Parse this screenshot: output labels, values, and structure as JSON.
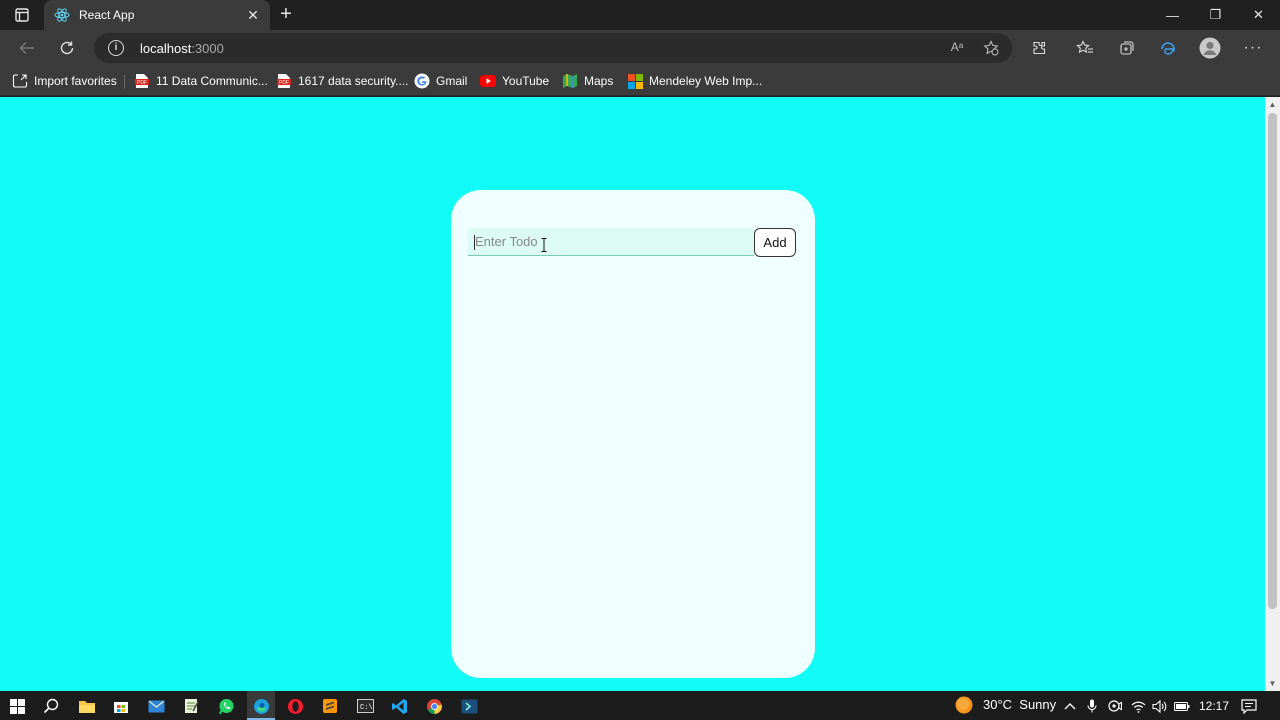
{
  "browser": {
    "tab_title": "React App",
    "tab_close": "✕",
    "new_tab": "+",
    "window_controls": {
      "minimize": "—",
      "restore": "❐",
      "close": "✕"
    }
  },
  "address_bar": {
    "host": "localhost",
    "port": ":3000",
    "info_glyph": "i",
    "read_aloud": "Aᵃ"
  },
  "favorites": [
    {
      "label": "Import favorites",
      "icon": "import-icon"
    },
    {
      "label": "11 Data Communic...",
      "icon": "pdf-icon"
    },
    {
      "label": "1617 data security....",
      "icon": "pdf-icon"
    },
    {
      "label": "Gmail",
      "icon": "google-icon"
    },
    {
      "label": "YouTube",
      "icon": "youtube-icon"
    },
    {
      "label": "Maps",
      "icon": "maps-icon"
    },
    {
      "label": "Mendeley Web Imp...",
      "icon": "microsoft-icon"
    }
  ],
  "todo": {
    "input_placeholder": "Enter Todo",
    "input_value": "",
    "add_label": "Add"
  },
  "colors": {
    "page_background": "#12fcf7",
    "card_background": "#effefe",
    "input_background": "#dcfbf2"
  },
  "taskbar": {
    "weather_temp": "30°C",
    "weather_text": "Sunny",
    "clock": "12:17"
  }
}
